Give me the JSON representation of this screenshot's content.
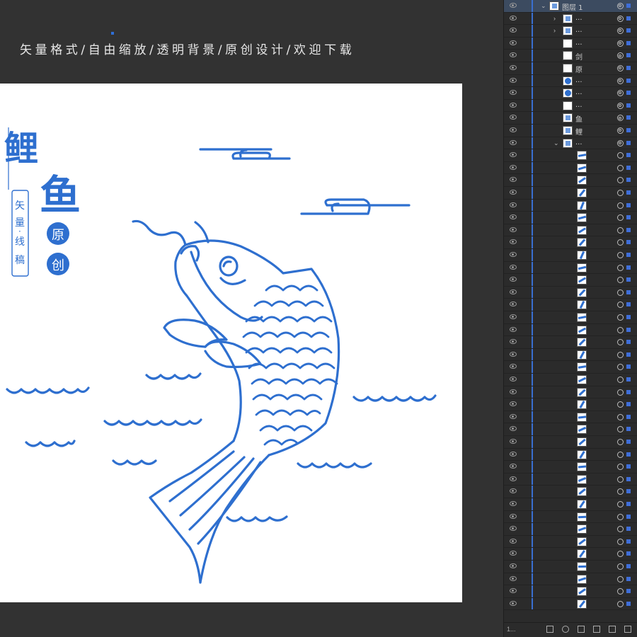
{
  "banner": "矢量格式/自由缩放/透明背景/原创设计/欢迎下载",
  "artwork": {
    "title_chars": [
      "鲤",
      "鱼"
    ],
    "vertical_label_chars": [
      "矢",
      "量",
      "·",
      "线",
      "稿"
    ],
    "badge_1": "原",
    "badge_2": "创",
    "line_color": "#2e6fcf"
  },
  "layers_panel": {
    "top_layer_name": "图层 1",
    "sublayers": [
      {
        "label": "...",
        "thumb": "sketch",
        "chevron": ">"
      },
      {
        "label": "...",
        "thumb": "sketch",
        "chevron": ">"
      },
      {
        "label": "...",
        "thumb": "blank"
      },
      {
        "label": "剑",
        "thumb": "blank"
      },
      {
        "label": "原",
        "thumb": "blank"
      },
      {
        "label": "...",
        "thumb": "dot"
      },
      {
        "label": "...",
        "thumb": "dot"
      },
      {
        "label": "...",
        "thumb": "dots"
      },
      {
        "label": "鱼",
        "thumb": "char"
      },
      {
        "label": "鲤",
        "thumb": "char"
      },
      {
        "label": "...",
        "thumb": "fish",
        "chevron": "v"
      }
    ],
    "path_rows": 37,
    "footer_count": "1..."
  }
}
